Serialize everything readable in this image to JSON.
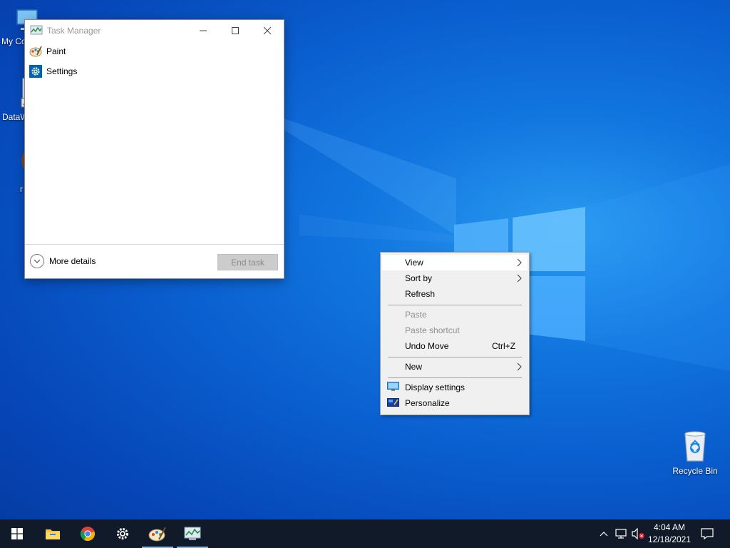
{
  "desktop_icons": [
    {
      "label": "My Co",
      "icon": "computer-icon"
    },
    {
      "label": "DataW",
      "icon": "shortcut-icon"
    },
    {
      "label": "r",
      "icon": "user-avatar-icon"
    }
  ],
  "recycle_bin": {
    "label": "Recycle Bin",
    "icon": "recycle-bin-icon"
  },
  "task_manager": {
    "title": "Task Manager",
    "apps": [
      {
        "name": "Paint",
        "icon": "paint-icon"
      },
      {
        "name": "Settings",
        "icon": "settings-gear-icon"
      }
    ],
    "more_details_label": "More details",
    "end_task_label": "End task"
  },
  "context_menu": {
    "items": [
      {
        "label": "View",
        "has_submenu": true
      },
      {
        "label": "Sort by",
        "has_submenu": true
      },
      {
        "label": "Refresh"
      },
      {
        "label": "Paste",
        "disabled": true
      },
      {
        "label": "Paste shortcut",
        "disabled": true
      },
      {
        "label": "Undo Move",
        "shortcut": "Ctrl+Z"
      },
      {
        "label": "New",
        "has_submenu": true
      },
      {
        "label": "Display settings",
        "icon": "display-icon"
      },
      {
        "label": "Personalize",
        "icon": "personalize-icon"
      }
    ]
  },
  "taskbar": {
    "pinned": [
      "start-icon",
      "file-explorer-icon",
      "chrome-icon",
      "settings-gear-icon",
      "paint-icon",
      "task-manager-icon"
    ],
    "clock_time": "4:04 AM",
    "clock_date": "12/18/2021"
  },
  "colors": {
    "taskbar": "#101a28",
    "menu_bg": "#f0f0f0",
    "accent": "#0078d7"
  }
}
